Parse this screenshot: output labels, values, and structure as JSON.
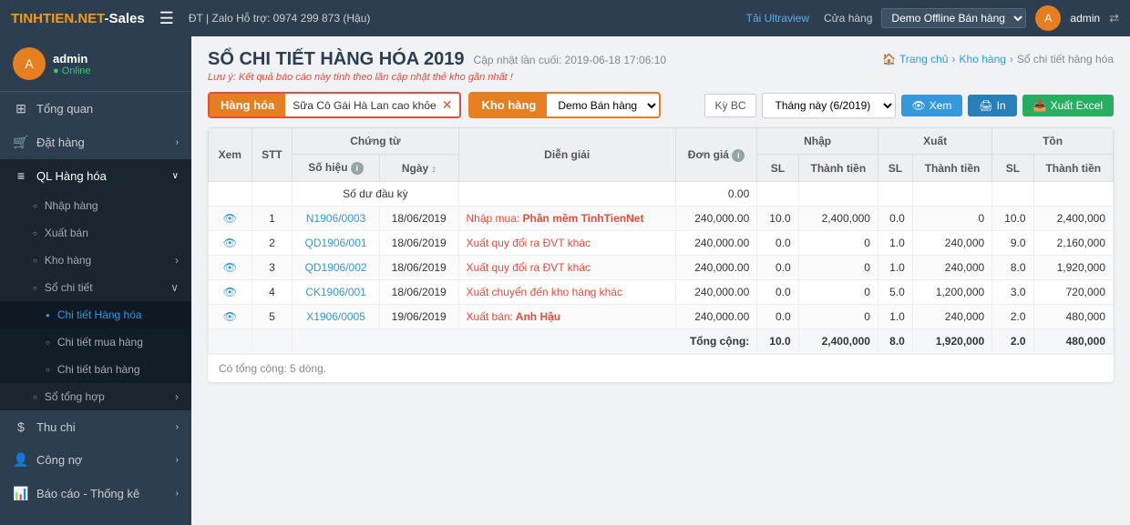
{
  "topbar": {
    "brand": "TINHTIEN.NET",
    "brand_suffix": "-Sales",
    "menu_icon": "☰",
    "contact": "ĐT | Zalo Hỗ trợ: 0974 299 873 (Hậu)",
    "ultraview": "Tải Ultraview",
    "store_label": "Cửa hàng",
    "store_value": "Demo Offline Bán hàng",
    "admin": "admin",
    "share_icon": "⇄"
  },
  "sidebar": {
    "username": "admin",
    "status": "● Online",
    "avatar_letter": "A",
    "items": [
      {
        "id": "tong-quan",
        "icon": "⊞",
        "label": "Tổng quan",
        "has_arrow": false
      },
      {
        "id": "dat-hang",
        "icon": "🛒",
        "label": "Đặt hàng",
        "has_arrow": true
      },
      {
        "id": "ql-hang-hoa",
        "icon": "≡",
        "label": "QL Hàng hóa",
        "has_arrow": true,
        "expanded": true
      },
      {
        "id": "nhap-hang",
        "icon": "○",
        "label": "Nhập hàng",
        "is_sub": true
      },
      {
        "id": "xuat-ban",
        "icon": "○",
        "label": "Xuất bán",
        "is_sub": true
      },
      {
        "id": "kho-hang",
        "icon": "○",
        "label": "Kho hàng",
        "is_sub": true,
        "has_arrow": true
      },
      {
        "id": "so-chi-tiet",
        "icon": "○",
        "label": "Sổ chi tiết",
        "is_sub": true,
        "expanded": true
      },
      {
        "id": "chi-tiet-hang-hoa",
        "icon": "●",
        "label": "Chi tiết Hàng hóa",
        "is_sub2": true,
        "active": true
      },
      {
        "id": "chi-tiet-mua-hang",
        "icon": "○",
        "label": "Chi tiết mua hàng",
        "is_sub2": true
      },
      {
        "id": "chi-tiet-ban-hang",
        "icon": "○",
        "label": "Chi tiết bán hàng",
        "is_sub2": true
      },
      {
        "id": "so-tong-hop",
        "icon": "○",
        "label": "Sổ tổng hợp",
        "is_sub": true,
        "has_arrow": true
      },
      {
        "id": "thu-chi",
        "icon": "$",
        "label": "Thu chi",
        "has_arrow": true
      },
      {
        "id": "cong-no",
        "icon": "👤",
        "label": "Công nợ",
        "has_arrow": true
      },
      {
        "id": "bao-cao",
        "icon": "📊",
        "label": "Báo cáo - Thống kê",
        "has_arrow": true
      }
    ]
  },
  "page": {
    "title": "SỔ CHI TIẾT HÀNG HÓA 2019",
    "update_label": "Cập nhật lần cuối:",
    "update_time": "2019-06-18 17:06:10",
    "note": "Lưu ý: Kết quả báo cáo này tính theo lần cập nhật thẻ kho gần nhất !",
    "breadcrumb": [
      "Trang chủ",
      "Kho hàng",
      "Sổ chi tiết hàng hóa"
    ]
  },
  "filters": {
    "tab_hanghoa": "Hàng hóa",
    "hanghoa_value": "Sữa Cô Gái Hà Lan cao khỏe",
    "tab_khohang": "Kho hàng",
    "khohang_value": "Demo Bán hàng",
    "kybc_label": "Kỳ BC",
    "period_label": "Tháng này (6/2019)",
    "btn_xem": "Xem",
    "btn_in": "In",
    "btn_excel": "Xuất Excel"
  },
  "table": {
    "headers": {
      "xem": "Xem",
      "stt": "STT",
      "chung_tu": "Chứng từ",
      "so_hieu": "Số hiệu",
      "ngay": "Ngày",
      "dien_giai": "Diễn giải",
      "don_gia": "Đơn giá",
      "nhap": "Nhập",
      "xuat": "Xuất",
      "ton": "Tồn",
      "sl": "SL",
      "thanh_tien": "Thành tiền"
    },
    "so_du_dau_ky": "Số dư đầu kỳ",
    "so_du_value": "0.00",
    "rows": [
      {
        "stt": "1",
        "so_hieu": "N1906/0003",
        "ngay": "18/06/2019",
        "dien_giai": "Nhập mua: Phần mềm TinhTienNet",
        "don_gia": "240,000.00",
        "nhap_sl": "10.0",
        "nhap_tt": "2,400,000",
        "xuat_sl": "0.0",
        "xuat_tt": "0",
        "ton_sl": "10.0",
        "ton_tt": "2,400,000"
      },
      {
        "stt": "2",
        "so_hieu": "QD1906/001",
        "ngay": "18/06/2019",
        "dien_giai": "Xuất quy đổi ra ĐVT khác",
        "don_gia": "240,000.00",
        "nhap_sl": "0.0",
        "nhap_tt": "0",
        "xuat_sl": "1.0",
        "xuat_tt": "240,000",
        "ton_sl": "9.0",
        "ton_tt": "2,160,000"
      },
      {
        "stt": "3",
        "so_hieu": "QD1906/002",
        "ngay": "18/06/2019",
        "dien_giai": "Xuất quy đổi ra ĐVT khác",
        "don_gia": "240,000.00",
        "nhap_sl": "0.0",
        "nhap_tt": "0",
        "xuat_sl": "1.0",
        "xuat_tt": "240,000",
        "ton_sl": "8.0",
        "ton_tt": "1,920,000"
      },
      {
        "stt": "4",
        "so_hieu": "CK1906/001",
        "ngay": "18/06/2019",
        "dien_giai": "Xuất chuyển đến kho hàng khác",
        "don_gia": "240,000.00",
        "nhap_sl": "0.0",
        "nhap_tt": "0",
        "xuat_sl": "5.0",
        "xuat_tt": "1,200,000",
        "ton_sl": "3.0",
        "ton_tt": "720,000"
      },
      {
        "stt": "5",
        "so_hieu": "X1906/0005",
        "ngay": "19/06/2019",
        "dien_giai": "Xuất bán: Anh Hậu",
        "don_gia": "240,000.00",
        "nhap_sl": "0.0",
        "nhap_tt": "0",
        "xuat_sl": "1.0",
        "xuat_tt": "240,000",
        "ton_sl": "2.0",
        "ton_tt": "480,000"
      }
    ],
    "tong_cong": {
      "label": "Tổng cộng:",
      "nhap_sl": "10.0",
      "nhap_tt": "2,400,000",
      "xuat_sl": "8.0",
      "xuat_tt": "1,920,000",
      "ton_sl": "2.0",
      "ton_tt": "480,000"
    },
    "footer_note": "Có tổng cộng: 5 dòng."
  }
}
